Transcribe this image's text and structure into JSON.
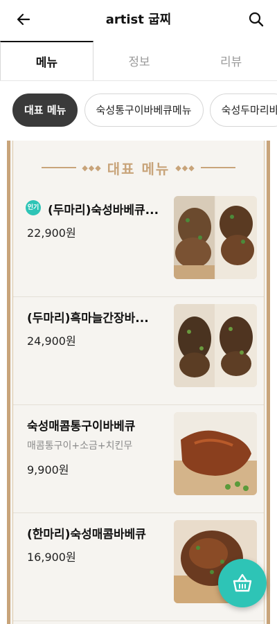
{
  "header": {
    "title": "artist 굽찌"
  },
  "tabs": [
    {
      "label": "메뉴",
      "active": true
    },
    {
      "label": "정보",
      "active": false
    },
    {
      "label": "리뷰",
      "active": false
    }
  ],
  "chips": [
    {
      "label": "대표 메뉴",
      "active": true
    },
    {
      "label": "숙성통구이바베큐메뉴",
      "active": false
    },
    {
      "label": "숙성두마리바",
      "active": false
    }
  ],
  "board": {
    "heading": "대표 메뉴"
  },
  "items": [
    {
      "name": "(두마리)숙성바베큐...",
      "badge": "인기",
      "description": "",
      "price": "22,900원"
    },
    {
      "name": "(두마리)흑마늘간장바...",
      "badge": "",
      "description": "",
      "price": "24,900원"
    },
    {
      "name": "숙성매콤통구이바베큐",
      "badge": "",
      "description": "매콤통구이+소금+치킨무",
      "price": "9,900원"
    },
    {
      "name": "(한마리)숙성매콤바베큐",
      "badge": "",
      "description": "",
      "price": "16,900원"
    }
  ],
  "colors": {
    "accent": "#2ec4b6",
    "gold": "#c8a47a",
    "chip_active": "#3a3a3a"
  },
  "icons": {
    "back": "arrow-left-icon",
    "search": "search-icon",
    "basket": "basket-icon"
  }
}
